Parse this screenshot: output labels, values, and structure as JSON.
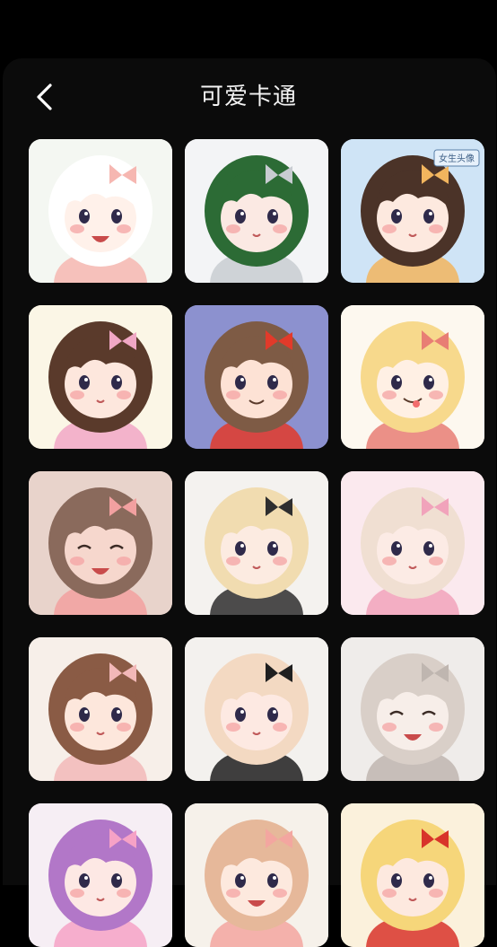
{
  "header": {
    "title": "可爱卡通",
    "back_icon": "chevron-left-icon"
  },
  "avatars": [
    {
      "bg": "#f4f7f2",
      "hair": "#ffffff",
      "skin": "#fff1ea",
      "accent": "#f6b7b1",
      "mouth": "open"
    },
    {
      "bg": "#f3f4f6",
      "hair": "#2c6b35",
      "skin": "#fbe9e3",
      "accent": "#c8ccd1",
      "mouth": "small"
    },
    {
      "bg": "#cfe4f6",
      "hair": "#4b3328",
      "skin": "#fde9df",
      "accent": "#f2b55e",
      "mouth": "small",
      "badge": "女生头像"
    },
    {
      "bg": "#fbf6e6",
      "hair": "#5a3a2b",
      "skin": "#fde7dd",
      "accent": "#f1a7c5",
      "mouth": "small"
    },
    {
      "bg": "#8c91cf",
      "hair": "#7e5b45",
      "skin": "#fde2d5",
      "accent": "#e23a2a",
      "mouth": "smile"
    },
    {
      "bg": "#fdf8ef",
      "hair": "#f7d98c",
      "skin": "#fff0e4",
      "accent": "#e87e74",
      "mouth": "tongue"
    },
    {
      "bg": "#e8d3cb",
      "hair": "#8a6a5c",
      "skin": "#f6d7cd",
      "accent": "#f2a0a0",
      "mouth": "laugh"
    },
    {
      "bg": "#f4f2ef",
      "hair": "#f1dcb0",
      "skin": "#fcebe1",
      "accent": "#2e2e2e",
      "mouth": "small"
    },
    {
      "bg": "#fbe9ee",
      "hair": "#f0dfd2",
      "skin": "#fcebe5",
      "accent": "#f1a3bb",
      "mouth": "small"
    },
    {
      "bg": "#f7efe9",
      "hair": "#8a5b45",
      "skin": "#fde7dc",
      "accent": "#f2b8b8",
      "mouth": "small"
    },
    {
      "bg": "#f3f1ee",
      "hair": "#f3d9c2",
      "skin": "#fde9e2",
      "accent": "#1f1f1f",
      "mouth": "small"
    },
    {
      "bg": "#efecea",
      "hair": "#d9cfc8",
      "skin": "#f7eee9",
      "accent": "#bfb6b0",
      "mouth": "laugh"
    },
    {
      "bg": "#f6eef4",
      "hair": "#b277c8",
      "skin": "#fde8e4",
      "accent": "#f6a2c6",
      "mouth": "small"
    },
    {
      "bg": "#f6f1ea",
      "hair": "#e6b89a",
      "skin": "#fde9de",
      "accent": "#f3a6a0",
      "mouth": "open"
    },
    {
      "bg": "#fbf1dc",
      "hair": "#f6d67a",
      "skin": "#fde9df",
      "accent": "#d8342a",
      "mouth": "small"
    }
  ]
}
